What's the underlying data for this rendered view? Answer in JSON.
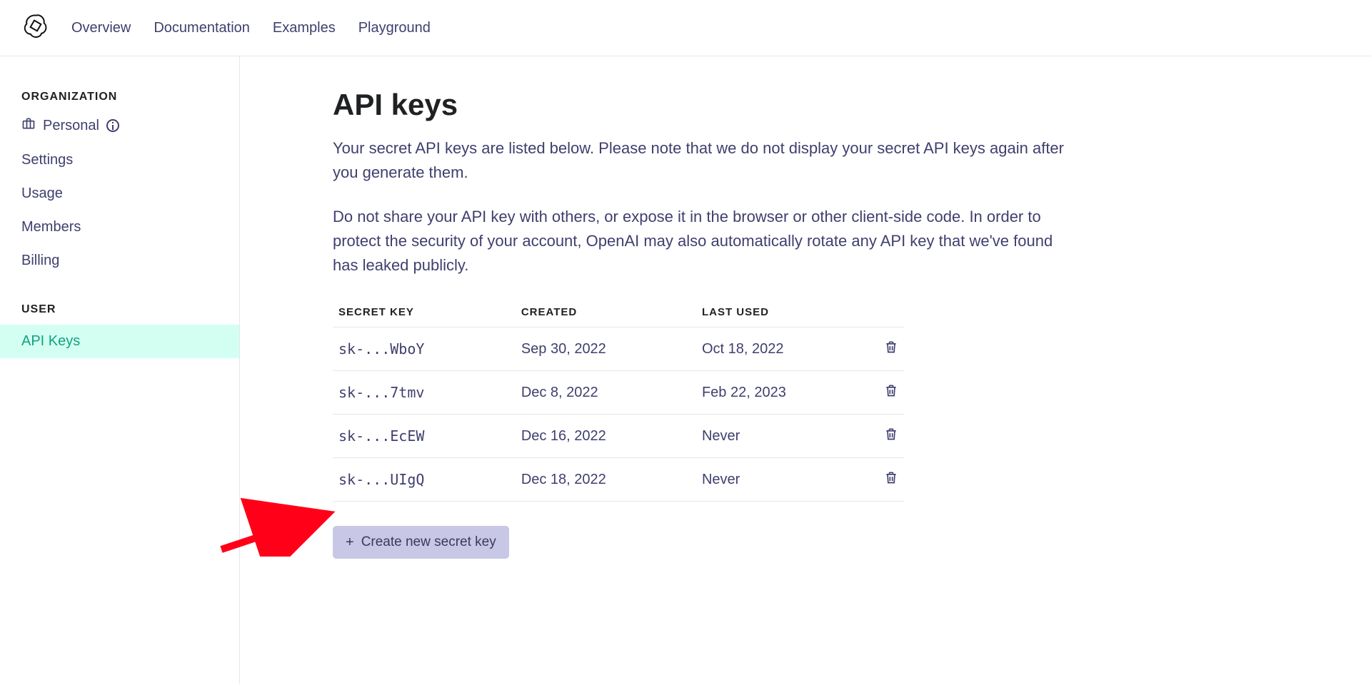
{
  "nav": {
    "items": [
      "Overview",
      "Documentation",
      "Examples",
      "Playground"
    ]
  },
  "sidebar": {
    "org_heading": "ORGANIZATION",
    "org_name": "Personal",
    "org_items": [
      "Settings",
      "Usage",
      "Members",
      "Billing"
    ],
    "user_heading": "USER",
    "user_items": [
      {
        "label": "API Keys",
        "active": true
      }
    ]
  },
  "page": {
    "title": "API keys",
    "para1": "Your secret API keys are listed below. Please note that we do not display your secret API keys again after you generate them.",
    "para2": "Do not share your API key with others, or expose it in the browser or other client-side code. In order to protect the security of your account, OpenAI may also automatically rotate any API key that we've found has leaked publicly."
  },
  "table": {
    "headers": [
      "SECRET KEY",
      "CREATED",
      "LAST USED"
    ],
    "rows": [
      {
        "key": "sk-...WboY",
        "created": "Sep 30, 2022",
        "last_used": "Oct 18, 2022"
      },
      {
        "key": "sk-...7tmv",
        "created": "Dec 8, 2022",
        "last_used": "Feb 22, 2023"
      },
      {
        "key": "sk-...EcEW",
        "created": "Dec 16, 2022",
        "last_used": "Never"
      },
      {
        "key": "sk-...UIgQ",
        "created": "Dec 18, 2022",
        "last_used": "Never"
      }
    ]
  },
  "create_button": "Create new secret key"
}
